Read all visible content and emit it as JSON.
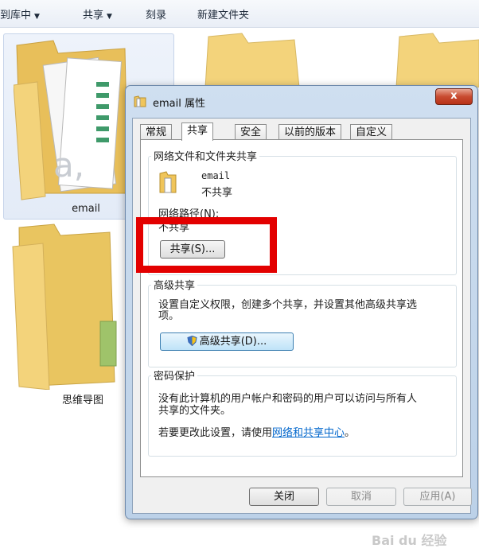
{
  "toolbar": {
    "include_library": "到库中",
    "share": "共享",
    "burn": "刻录",
    "new_folder": "新建文件夹"
  },
  "folders": {
    "email": "email",
    "mindmap": "思维导图"
  },
  "dialog": {
    "title": "email 属性",
    "close": "x",
    "tabs": [
      "常规",
      "共享",
      "安全",
      "以前的版本",
      "自定义"
    ],
    "network_sharing": {
      "group_title": "网络文件和文件夹共享",
      "item_name": "email",
      "item_status": "不共享",
      "network_path_label": "网络路径(N):",
      "network_path_value": "不共享",
      "share_button": "共享(S)..."
    },
    "advanced_sharing": {
      "group_title": "高级共享",
      "description_line1": "设置自定义权限，创建多个共享，并设置其他高级共享选",
      "description_line2": "项。",
      "button": "高级共享(D)..."
    },
    "password": {
      "group_title": "密码保护",
      "text_line1": "没有此计算机的用户帐户和密码的用户可以访问与所有人",
      "text_line2": "共享的文件夹。",
      "change_prefix": "若要更改此设置，请使用",
      "change_link": "网络和共享中心",
      "change_suffix": "。"
    },
    "buttons": {
      "close": "关闭",
      "cancel": "取消",
      "apply": "应用(A)"
    }
  },
  "watermark": "Bai du 经验",
  "colors": {
    "highlight_box": "#e30000",
    "link": "#0066cc",
    "folder": "#f3d37b"
  }
}
